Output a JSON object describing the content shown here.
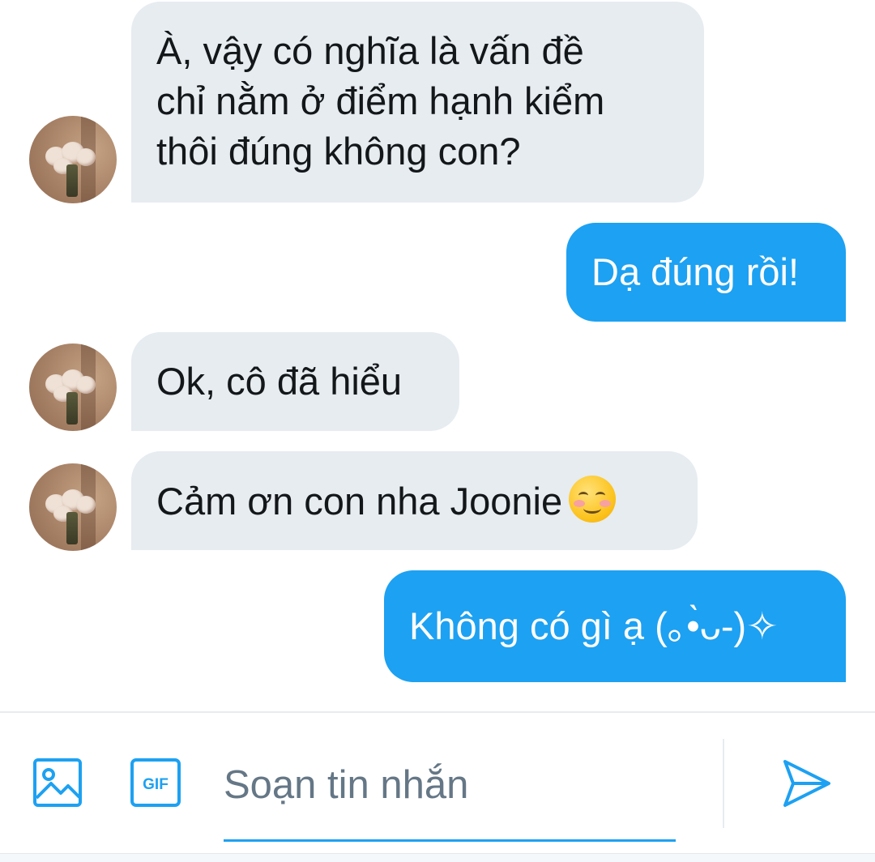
{
  "conversation": {
    "messages": [
      {
        "direction": "incoming",
        "lines": [
          "À, vậy có nghĩa là vấn đề",
          "chỉ nằm ở điểm hạnh kiểm",
          "thôi đúng không con?"
        ]
      },
      {
        "direction": "outgoing",
        "lines": [
          "Dạ đúng rồi!"
        ]
      },
      {
        "direction": "incoming",
        "lines": [
          "Ok, cô đã hiểu"
        ]
      },
      {
        "direction": "incoming",
        "lines": [
          "Cảm ơn con nha Joonie"
        ],
        "emoji": "smiling-face-emoji"
      },
      {
        "direction": "outgoing",
        "lines": [
          "Không có gì ạ (｡•̀ᴗ-)✧"
        ]
      }
    ]
  },
  "composer": {
    "placeholder": "Soạn tin nhắn",
    "value": "",
    "gif_label": "GIF",
    "icons": {
      "media": "image-icon",
      "gif": "gif-icon",
      "send": "send-icon"
    }
  },
  "colors": {
    "incoming_bubble": "#e6ecf0",
    "outgoing_bubble": "#1da1f2",
    "accent": "#1da1f2",
    "text": "#14171a",
    "placeholder": "#657786"
  }
}
